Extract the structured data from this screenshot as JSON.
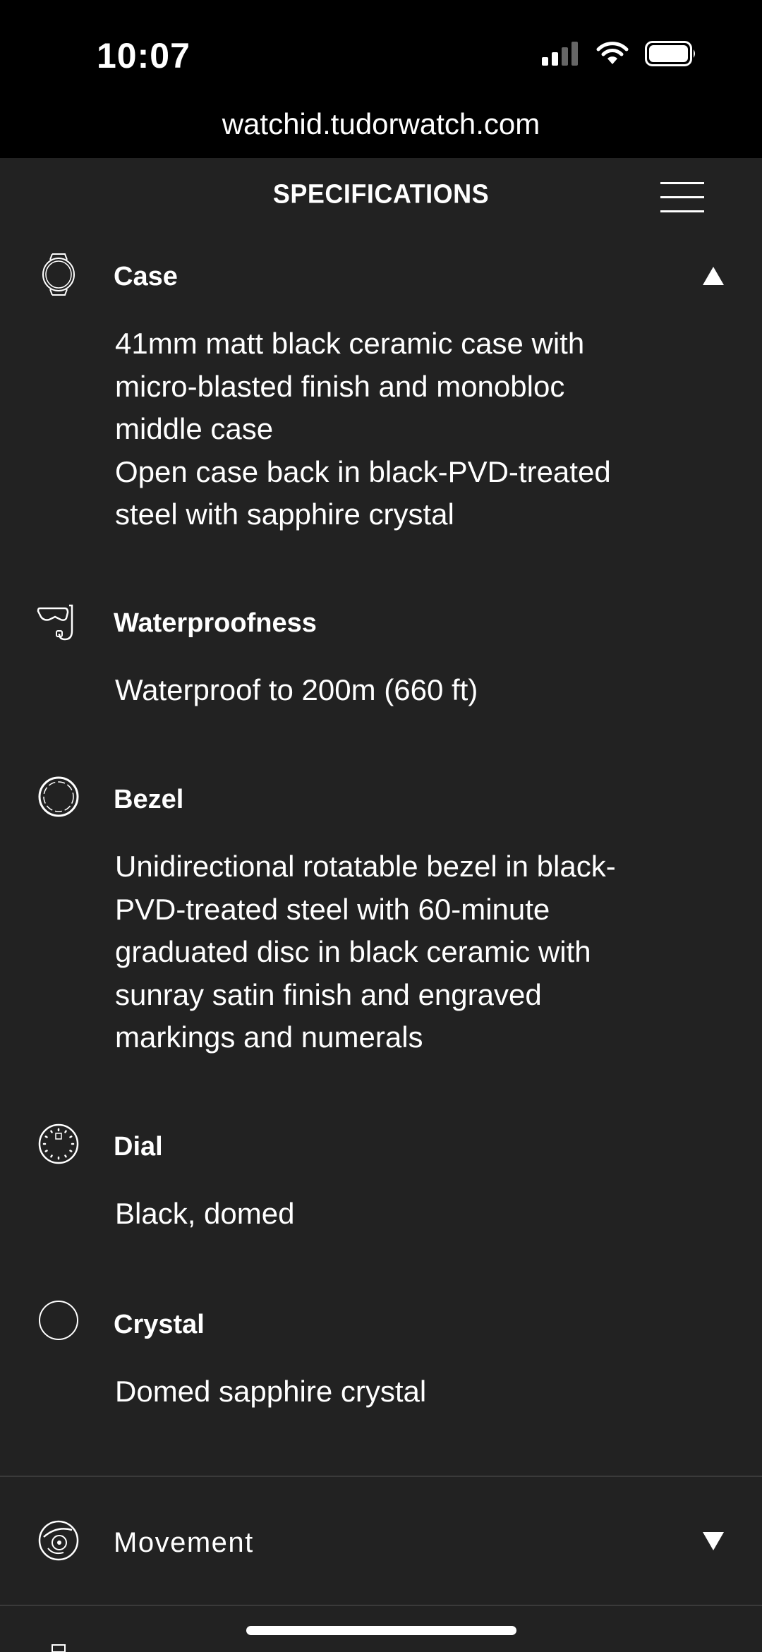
{
  "status": {
    "time": "10:07"
  },
  "browser": {
    "url": "watchid.tudorwatch.com"
  },
  "header": {
    "title": "SPECIFICATIONS"
  },
  "specs": [
    {
      "label": "Case",
      "icon": "watch-case-icon",
      "text": "41mm matt black ceramic case with\nmicro-blasted finish and monobloc\nmiddle case\nOpen case back in black-PVD-treated\nsteel with sapphire crystal"
    },
    {
      "label": "Waterproofness",
      "icon": "dive-mask-icon",
      "text": "Waterproof to 200m (660 ft)"
    },
    {
      "label": "Bezel",
      "icon": "bezel-icon",
      "text": "Unidirectional rotatable bezel in black-\nPVD-treated steel with 60-minute\ngraduated disc in black ceramic with\nsunray satin finish and engraved\nmarkings and numerals"
    },
    {
      "label": "Dial",
      "icon": "dial-icon",
      "text": "Black, domed"
    },
    {
      "label": "Crystal",
      "icon": "crystal-icon",
      "text": "Domed sapphire crystal"
    }
  ],
  "movement": {
    "label": "Movement",
    "icon": "movement-icon"
  }
}
